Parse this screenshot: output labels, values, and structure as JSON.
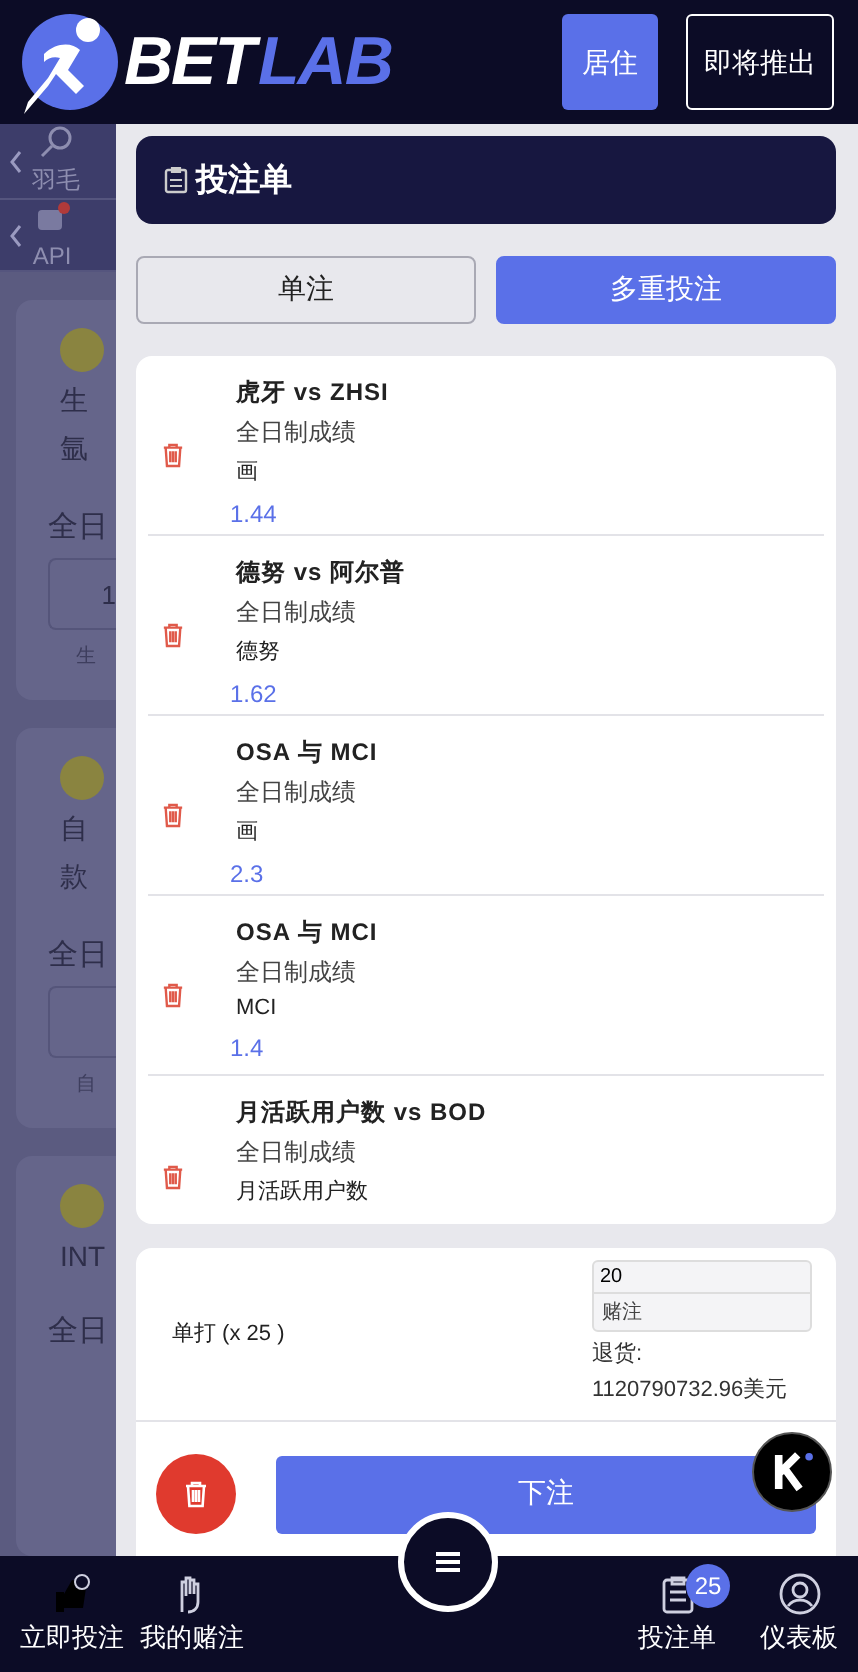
{
  "header": {
    "logo": {
      "part_1": "BET",
      "part_2": "LAB"
    },
    "buttons": [
      {
        "label": "居住",
        "kind": "primary"
      },
      {
        "label": "即将推出",
        "kind": "outline"
      }
    ]
  },
  "background": {
    "nav": [
      {
        "label": "羽毛",
        "kind": "search"
      },
      {
        "label": "API",
        "kind": "chat"
      }
    ],
    "cards": [
      {
        "lines": [
          "生",
          "氩"
        ],
        "market": "全日",
        "kind": "odds",
        "odds": "1",
        "footer": "生"
      },
      {
        "lines": [
          "自",
          "款"
        ],
        "market": "全日",
        "kind": "odds",
        "footer": "自"
      },
      {
        "lines": [
          "INT"
        ],
        "market": "全日"
      }
    ]
  },
  "betslip": {
    "title": "投注单",
    "tabs": [
      {
        "label": "单注",
        "selected": false
      },
      {
        "label": "多重投注",
        "selected": true
      }
    ],
    "selections": [
      {
        "match": "虎牙 vs ZHSI",
        "market": "全日制成绩",
        "pick": "画",
        "odds": "1.44"
      },
      {
        "match": "德努 vs 阿尔普",
        "market": "全日制成绩",
        "pick": "德努",
        "odds": "1.62"
      },
      {
        "match": "OSA 与 MCI",
        "market": "全日制成绩",
        "pick": "画",
        "odds": "2.3"
      },
      {
        "match": "OSA 与 MCI",
        "market": "全日制成绩",
        "pick": "MCI",
        "odds": "1.4"
      },
      {
        "match": "月活跃用户数 vs BOD",
        "market": "全日制成绩",
        "pick": "月活跃用户数"
      }
    ],
    "summary": {
      "label": "单打 (x 25 )",
      "stake": {
        "value": "20",
        "label": "赌注"
      },
      "returns_label": "退货:",
      "returns": "1120790732.96美元"
    },
    "place_bet": "下注"
  },
  "bottom_nav": [
    {
      "label": "立即投注",
      "kind": "bet"
    },
    {
      "label": "我的赌注",
      "kind": "hand"
    },
    {
      "label": "投注单",
      "kind": "slip",
      "badge": "25"
    },
    {
      "label": "仪表板",
      "kind": "user"
    }
  ]
}
